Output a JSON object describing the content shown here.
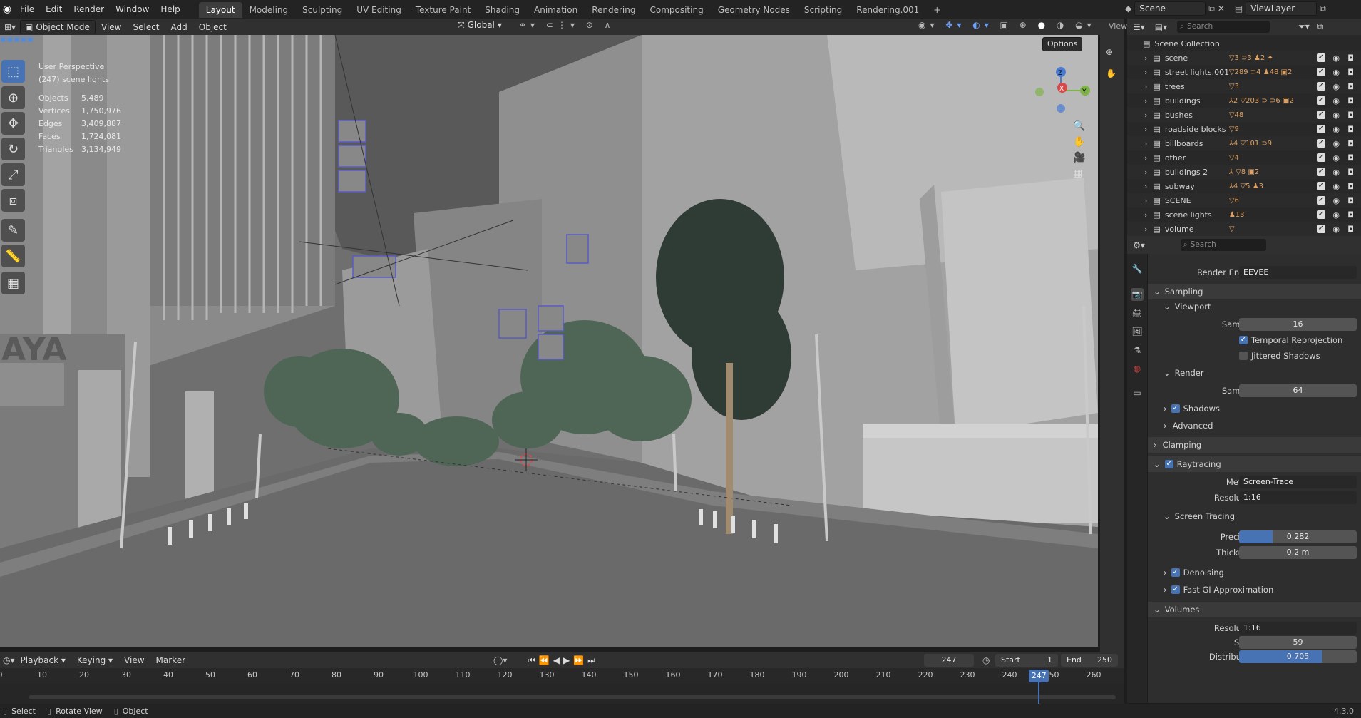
{
  "topbar": {
    "menus": [
      "File",
      "Edit",
      "Render",
      "Window",
      "Help"
    ],
    "workspaces": [
      "Layout",
      "Modeling",
      "Sculpting",
      "UV Editing",
      "Texture Paint",
      "Shading",
      "Animation",
      "Rendering",
      "Compositing",
      "Geometry Nodes",
      "Scripting",
      "Rendering.001"
    ],
    "add_tab": "+",
    "scene": "Scene",
    "view_layer": "ViewLayer"
  },
  "viewport_header": {
    "mode": "Object Mode",
    "menus": [
      "View",
      "Select",
      "Add",
      "Object"
    ],
    "orientation": "Global",
    "options": "Options"
  },
  "overlay": {
    "perspective": "User Perspective",
    "collection": "(247) scene lights",
    "stats": [
      {
        "label": "Objects",
        "value": "5,489"
      },
      {
        "label": "Vertices",
        "value": "1,750,976"
      },
      {
        "label": "Edges",
        "value": "3,409,887"
      },
      {
        "label": "Faces",
        "value": "1,724,081"
      },
      {
        "label": "Triangles",
        "value": "3,134,949"
      }
    ],
    "billboard_text": "AYA",
    "gizmo": {
      "z": "Z",
      "x": "X",
      "y": "Y"
    }
  },
  "outliner": {
    "search_placeholder": "Search",
    "root": "Scene Collection",
    "items": [
      {
        "name": "scene",
        "badges": "▽3 ⊃3 ♟2 ✦"
      },
      {
        "name": "street lights.001",
        "badges": "▽289 ⊃4 ♟48 ▣2"
      },
      {
        "name": "trees",
        "badges": "▽3"
      },
      {
        "name": "buildings",
        "badges": "⅄2 ▽203 ⊃ ⊃6 ▣2"
      },
      {
        "name": "bushes",
        "badges": "▽48"
      },
      {
        "name": "roadside blocks",
        "badges": "▽9"
      },
      {
        "name": "billboards",
        "badges": "⅄4 ▽101 ⊃9"
      },
      {
        "name": "other",
        "badges": "▽4"
      },
      {
        "name": "buildings 2",
        "badges": "⅄ ▽8 ▣2"
      },
      {
        "name": "subway",
        "badges": "⅄4 ▽5 ♟3"
      },
      {
        "name": "SCENE",
        "badges": "▽6"
      },
      {
        "name": "scene lights",
        "badges": "♟13"
      },
      {
        "name": "volume",
        "badges": "▽"
      }
    ],
    "view_label": "View"
  },
  "properties": {
    "search_placeholder": "Search",
    "render_engine_label": "Render Engine",
    "render_engine": "EEVEE",
    "sampling": "Sampling",
    "viewport": "Viewport",
    "samples_label": "Samples",
    "viewport_samples": "16",
    "temporal_reprojection": "Temporal Reprojection",
    "jittered_shadows": "Jittered Shadows",
    "render": "Render",
    "render_samples": "64",
    "shadows": "Shadows",
    "advanced": "Advanced",
    "clamping": "Clamping",
    "raytracing": "Raytracing",
    "method_label": "Method",
    "method": "Screen-Trace",
    "resolution_label": "Resolution",
    "resolution": "1:16",
    "screen_tracing": "Screen Tracing",
    "precision_label": "Precision",
    "precision": "0.282",
    "precision_fill": 0.282,
    "thickness_label": "Thickness",
    "thickness": "0.2 m",
    "denoising": "Denoising",
    "fast_gi": "Fast GI Approximation",
    "volumes": "Volumes",
    "vol_resolution": "1:16",
    "steps_label": "Steps",
    "steps": "59",
    "distribution_label": "Distribution",
    "distribution": "0.705",
    "distribution_fill": 0.705
  },
  "timeline": {
    "menus": [
      "Playback",
      "Keying",
      "View",
      "Marker"
    ],
    "current_frame": "247",
    "start_label": "Start",
    "start": "1",
    "end_label": "End",
    "end": "250",
    "ticks": [
      "0",
      "10",
      "20",
      "30",
      "40",
      "50",
      "60",
      "70",
      "80",
      "90",
      "100",
      "110",
      "120",
      "130",
      "140",
      "150",
      "160",
      "170",
      "180",
      "190",
      "200",
      "210",
      "220",
      "230",
      "240",
      "250",
      "260"
    ]
  },
  "status": {
    "select": "Select",
    "rotate": "Rotate View",
    "object": "Object",
    "version": "4.3.0"
  }
}
